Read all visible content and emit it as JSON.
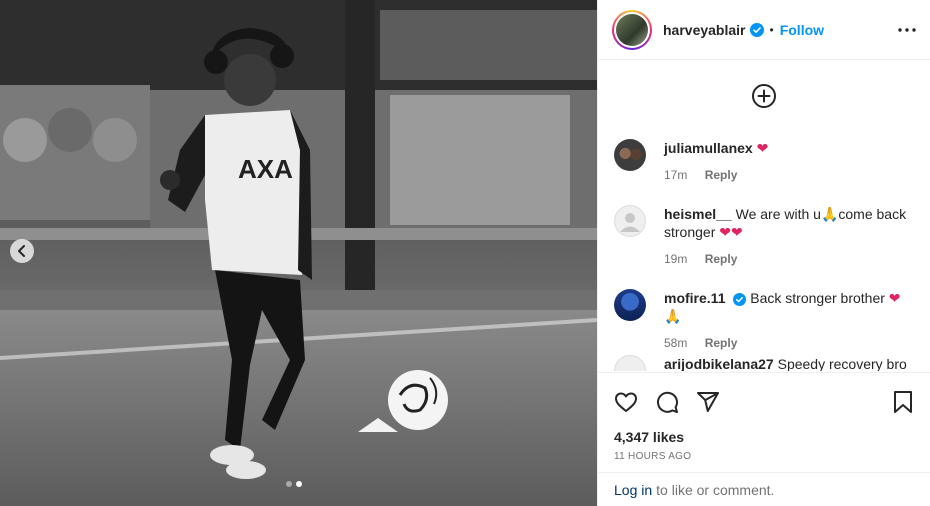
{
  "post": {
    "username": "harveyablair",
    "separator": "•",
    "follow_label": "Follow",
    "verified": true
  },
  "comments": [
    {
      "user": "juliamullanex",
      "text": "",
      "emoji": "❤",
      "time": "17m",
      "reply": "Reply"
    },
    {
      "user": "heismel__",
      "text": "We are with u",
      "text2": "come back stronger",
      "emoji": "❤❤",
      "time": "19m",
      "reply": "Reply"
    },
    {
      "user": "mofire.11",
      "text": "Back stronger brother",
      "emoji": "❤",
      "time": "58m",
      "reply": "Reply",
      "verified": true
    },
    {
      "user": "arijodbikelana27",
      "text": "Speedy recovery bro"
    }
  ],
  "stats": {
    "likes": "4,347 likes",
    "posted": "11 HOURS AGO"
  },
  "login": {
    "link": "Log in",
    "rest": "to like or comment."
  },
  "icons": {
    "add": "plus-circle-icon",
    "like": "heart-icon",
    "comment": "comment-icon",
    "share": "share-icon",
    "save": "bookmark-icon",
    "more": "more-icon",
    "prev": "chevron-left-icon"
  },
  "colors": {
    "accent": "#0095f6",
    "verified": "#0095f6",
    "heart": "#e0245e",
    "link": "#00376b"
  },
  "carousel": {
    "slides": 2,
    "current": 2
  }
}
